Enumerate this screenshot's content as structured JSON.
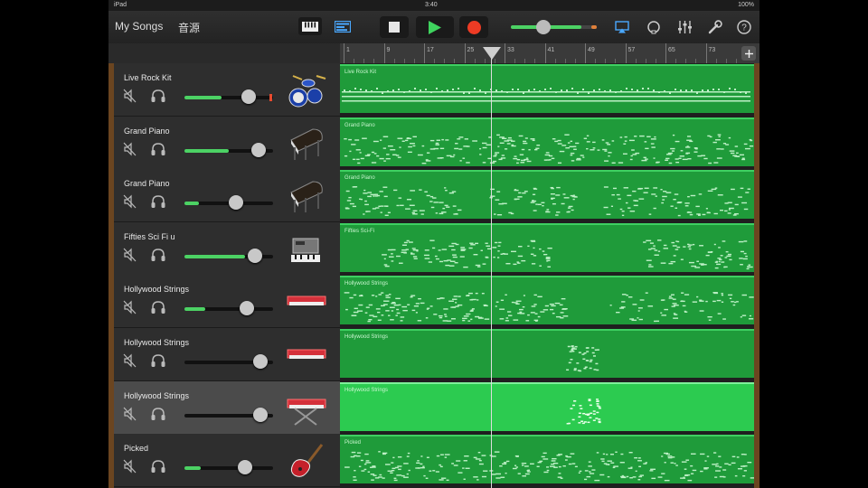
{
  "status": {
    "device": "iPad",
    "time": "3:40",
    "battery": "100%"
  },
  "toolbar": {
    "my_songs": "My Songs",
    "sounds": "音源",
    "master_volume": 0.82
  },
  "ruler": {
    "marks": [
      "1",
      "9",
      "17",
      "25",
      "33",
      "41",
      "49",
      "57",
      "65",
      "73"
    ]
  },
  "tracks": [
    {
      "name": "Live Rock Kit",
      "region": "Live Rock Kit",
      "volume": 0.72,
      "instrument": "drums-icon",
      "rec": true,
      "selected": false
    },
    {
      "name": "Grand Piano",
      "region": "Grand Piano",
      "volume": 0.84,
      "instrument": "grand-piano-icon",
      "rec": false,
      "selected": false
    },
    {
      "name": "Grand Piano",
      "region": "Grand Piano",
      "volume": 0.58,
      "instrument": "grand-piano-icon",
      "rec": false,
      "selected": false
    },
    {
      "name": "Fifties Sci Fi u",
      "region": "Fifties Sci-Fi",
      "volume": 0.8,
      "instrument": "synth-icon",
      "rec": false,
      "selected": false
    },
    {
      "name": "Hollywood Strings",
      "region": "Hollywood Strings",
      "volume": 0.7,
      "instrument": "keyboard-icon",
      "rec": false,
      "selected": false
    },
    {
      "name": "Hollywood Strings",
      "region": "Hollywood Strings",
      "volume": 0.86,
      "instrument": "keyboard-icon",
      "rec": false,
      "selected": false
    },
    {
      "name": "Hollywood Strings",
      "region": "Hollywood Strings",
      "volume": 0.86,
      "instrument": "keyboard-stand-icon",
      "rec": false,
      "selected": true
    },
    {
      "name": "Picked",
      "region": "Picked",
      "volume": 0.68,
      "instrument": "bass-guitar-icon",
      "rec": false,
      "selected": false
    }
  ],
  "colors": {
    "accent": "#4cd264",
    "region": "#1f9b3a",
    "region_selected": "#2ccb50",
    "record": "#e8412e"
  }
}
